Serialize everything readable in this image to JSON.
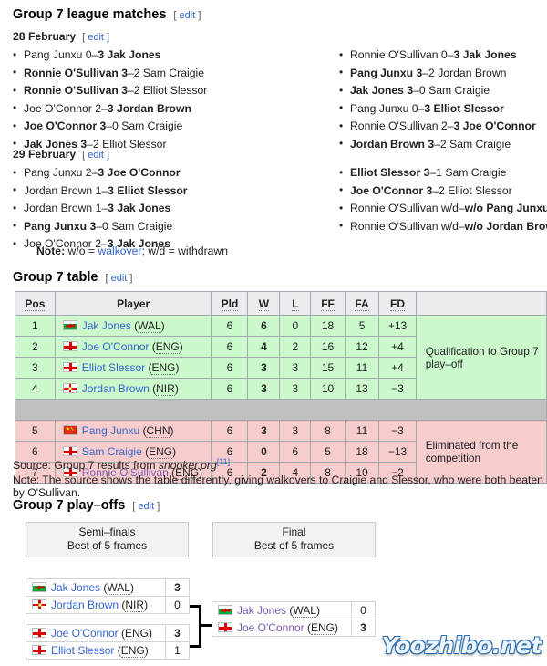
{
  "sections": {
    "league_matches": {
      "title": "Group 7 league matches",
      "edit": "edit",
      "bracket_open": "[",
      "bracket_close": "]"
    },
    "group_table": {
      "title": "Group 7 table",
      "edit": "edit"
    },
    "play_offs": {
      "title": "Group 7 play–offs",
      "edit": "edit"
    }
  },
  "day1": {
    "label": "28 February",
    "edit": "edit",
    "left": [
      {
        "p1": "Pang Junxu",
        "s1": "0",
        "dash": "–",
        "s2": "3",
        "p2": "Jak Jones",
        "bold": "right",
        "text": "Pang Junxu 0–3 Jak Jones"
      },
      {
        "p1": "Ronnie O'Sullivan",
        "s1": "3",
        "dash": "–",
        "s2": "2",
        "p2": "Sam Craigie",
        "bold": "left",
        "text": "Ronnie O'Sullivan 3–2 Sam Craigie"
      },
      {
        "p1": "Ronnie O'Sullivan",
        "s1": "3",
        "dash": "–",
        "s2": "2",
        "p2": "Elliot Slessor",
        "bold": "left",
        "text": "Ronnie O'Sullivan 3–2 Elliot Slessor"
      },
      {
        "p1": "Joe O'Connor",
        "s1": "2",
        "dash": "–",
        "s2": "3",
        "p2": "Jordan Brown",
        "bold": "right",
        "text": "Joe O'Connor 2–3 Jordan Brown"
      },
      {
        "p1": "Joe O'Connor",
        "s1": "3",
        "dash": "–",
        "s2": "0",
        "p2": "Sam Craigie",
        "bold": "left",
        "text": "Joe O'Connor 3–0 Sam Craigie"
      },
      {
        "p1": "Jak Jones",
        "s1": "3",
        "dash": "–",
        "s2": "2",
        "p2": "Elliot Slessor",
        "bold": "left",
        "text": "Jak Jones 3–2 Elliot Slessor"
      }
    ],
    "right": [
      {
        "p1": "Ronnie O'Sullivan",
        "s1": "0",
        "dash": "–",
        "s2": "3",
        "p2": "Jak Jones",
        "bold": "right",
        "text": "Ronnie O'Sullivan 0–3 Jak Jones"
      },
      {
        "p1": "Pang Junxu",
        "s1": "3",
        "dash": "–",
        "s2": "2",
        "p2": "Jordan Brown",
        "bold": "left",
        "text": "Pang Junxu 3–2 Jordan Brown"
      },
      {
        "p1": "Jak Jones",
        "s1": "3",
        "dash": "–",
        "s2": "0",
        "p2": "Sam Craigie",
        "bold": "left",
        "text": "Jak Jones 3–0 Sam Craigie"
      },
      {
        "p1": "Pang Junxu",
        "s1": "0",
        "dash": "–",
        "s2": "3",
        "p2": "Elliot Slessor",
        "bold": "right",
        "text": "Pang Junxu 0–3 Elliot Slessor"
      },
      {
        "p1": "Ronnie O'Sullivan",
        "s1": "2",
        "dash": "–",
        "s2": "3",
        "p2": "Joe O'Connor",
        "bold": "right",
        "text": "Ronnie O'Sullivan 2–3 Joe O'Connor"
      },
      {
        "p1": "Jordan Brown",
        "s1": "3",
        "dash": "–",
        "s2": "2",
        "p2": "Sam Craigie",
        "bold": "left",
        "text": "Jordan Brown 3–2 Sam Craigie"
      }
    ]
  },
  "day2": {
    "label": "29 February",
    "edit": "edit",
    "left": [
      {
        "p1": "Pang Junxu",
        "s1": "2",
        "dash": "–",
        "s2": "3",
        "p2": "Joe O'Connor",
        "bold": "right",
        "text": "Pang Junxu 2–3 Joe O'Connor"
      },
      {
        "p1": "Jordan Brown",
        "s1": "1",
        "dash": "–",
        "s2": "3",
        "p2": "Elliot Slessor",
        "bold": "right",
        "text": "Jordan Brown 1–3 Elliot Slessor"
      },
      {
        "p1": "Jordan Brown",
        "s1": "1",
        "dash": "–",
        "s2": "3",
        "p2": "Jak Jones",
        "bold": "right",
        "text": "Jordan Brown 1–3 Jak Jones"
      },
      {
        "p1": "Pang Junxu",
        "s1": "3",
        "dash": "–",
        "s2": "0",
        "p2": "Sam Craigie",
        "bold": "left",
        "text": "Pang Junxu 3–0 Sam Craigie"
      },
      {
        "p1": "Joe O'Connor",
        "s1": "2",
        "dash": "–",
        "s2": "3",
        "p2": "Jak Jones",
        "bold": "right",
        "text": "Joe O'Connor 2–3 Jak Jones"
      }
    ],
    "right": [
      {
        "p1": "Elliot Slessor",
        "s1": "3",
        "dash": "–",
        "s2": "1",
        "p2": "Sam Craigie",
        "bold": "left",
        "text": "Elliot Slessor 3–1 Sam Craigie"
      },
      {
        "p1": "Joe O'Connor",
        "s1": "3",
        "dash": "–",
        "s2": "2",
        "p2": "Elliot Slessor",
        "bold": "left",
        "text": "Joe O'Connor 3–2 Elliot Slessor"
      },
      {
        "p1": "Ronnie O'Sullivan",
        "s1": "w/d",
        "dash": "–",
        "s2": "w/o",
        "p2": "Pang Junxu",
        "bold": "right",
        "text": "Ronnie O'Sullivan w/d–w/o Pang Junxu"
      },
      {
        "p1": "Ronnie O'Sullivan",
        "s1": "w/d",
        "dash": "–",
        "s2": "w/o",
        "p2": "Jordan Brown",
        "bold": "right",
        "text": "Ronnie O'Sullivan w/d–w/o Jordan Brown"
      }
    ],
    "note_prefix": "Note:",
    "note_a": " w/o = ",
    "note_link": "walkover",
    "note_b": "; w/d = withdrawn"
  },
  "table": {
    "headers": [
      "Pos",
      "Player",
      "Pld",
      "W",
      "L",
      "FF",
      "FA",
      "FD",
      ""
    ],
    "rows": [
      {
        "pos": "1",
        "flag": "wal",
        "player": "Jak Jones",
        "country": "WAL",
        "pld": "6",
        "w": "6",
        "l": "0",
        "ff": "18",
        "fa": "5",
        "fd": "+13",
        "zone": "green",
        "visited": false
      },
      {
        "pos": "2",
        "flag": "eng",
        "player": "Joe O'Connor",
        "country": "ENG",
        "pld": "6",
        "w": "4",
        "l": "2",
        "ff": "16",
        "fa": "12",
        "fd": "+4",
        "zone": "green",
        "visited": false
      },
      {
        "pos": "3",
        "flag": "eng",
        "player": "Elliot Slessor",
        "country": "ENG",
        "pld": "6",
        "w": "3",
        "l": "3",
        "ff": "15",
        "fa": "11",
        "fd": "+4",
        "zone": "green",
        "visited": false
      },
      {
        "pos": "4",
        "flag": "nir",
        "player": "Jordan Brown",
        "country": "NIR",
        "pld": "6",
        "w": "3",
        "l": "3",
        "ff": "10",
        "fa": "13",
        "fd": "−3",
        "zone": "green",
        "visited": false
      },
      {
        "pos": "5",
        "flag": "chn",
        "player": "Pang Junxu",
        "country": "CHN",
        "pld": "6",
        "w": "3",
        "l": "3",
        "ff": "8",
        "fa": "11",
        "fd": "−3",
        "zone": "red",
        "visited": false
      },
      {
        "pos": "6",
        "flag": "eng",
        "player": "Sam Craigie",
        "country": "ENG",
        "pld": "6",
        "w": "0",
        "l": "6",
        "ff": "5",
        "fa": "18",
        "fd": "−13",
        "zone": "red",
        "visited": false
      },
      {
        "pos": "7",
        "flag": "eng",
        "player": "Ronnie O'Sullivan",
        "country": "ENG",
        "pld": "6",
        "w": "2",
        "l": "4",
        "ff": "8",
        "fa": "10",
        "fd": "−2",
        "zone": "red",
        "visited": true
      }
    ],
    "zone_green_label": "Qualification to Group 7 play–off",
    "zone_red_label": "Eliminated from the competition",
    "source_prefix": "Source: Group 7 results from ",
    "source_italic": "snooker.org",
    "source_ref": "[11]",
    "note": "Note: The source shows the table differently, giving walkovers to Craigie and Slessor, who were both beaten by O'Sullivan."
  },
  "playoffs": {
    "rounds": [
      {
        "name": "Semi–finals",
        "format": "Best of 5 frames"
      },
      {
        "name": "Final",
        "format": "Best of 5 frames"
      }
    ],
    "semi1": [
      {
        "flag": "wal",
        "player": "Jak Jones",
        "country": "WAL",
        "score": "3",
        "winner": true,
        "visited": false
      },
      {
        "flag": "nir",
        "player": "Jordan Brown",
        "country": "NIR",
        "score": "0",
        "winner": false,
        "visited": false
      }
    ],
    "semi2": [
      {
        "flag": "eng",
        "player": "Joe O'Connor",
        "country": "ENG",
        "score": "3",
        "winner": true,
        "visited": false
      },
      {
        "flag": "eng",
        "player": "Elliot Slessor",
        "country": "ENG",
        "score": "1",
        "winner": false,
        "visited": false
      }
    ],
    "final": [
      {
        "flag": "wal",
        "player": "Jak Jones",
        "country": "WAL",
        "score": "0",
        "winner": false,
        "visited": true
      },
      {
        "flag": "eng",
        "player": "Joe O'Connor",
        "country": "ENG",
        "score": "3",
        "winner": true,
        "visited": true
      }
    ]
  },
  "watermark": "Yoozhibo.net"
}
